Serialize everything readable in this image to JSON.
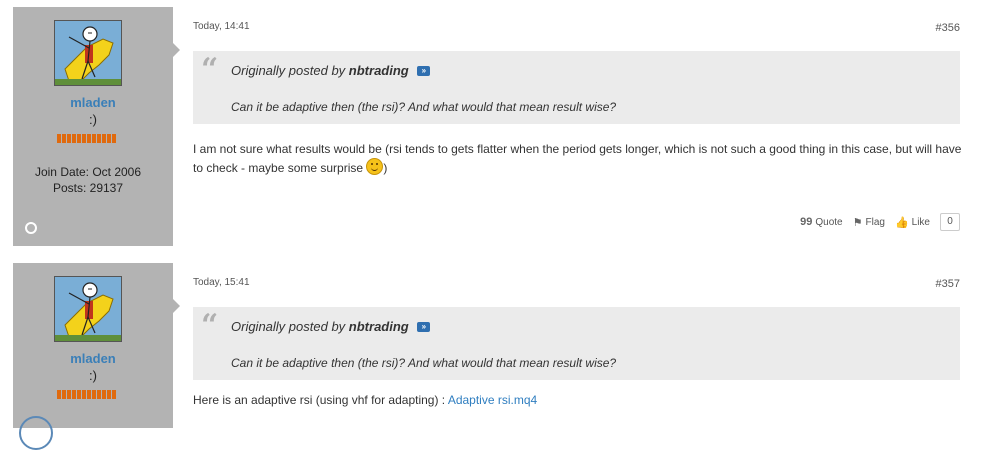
{
  "posts": [
    {
      "username": "mladen",
      "usertitle": ":)",
      "join_date": "Join Date: Oct 2006",
      "post_count": "Posts: 29137",
      "date": "Today, 14:41",
      "number": "#356",
      "quote": {
        "prefix": "Originally posted by",
        "author": "nbtrading",
        "text": "Can it be adaptive then (the rsi)? And what would that mean result wise?"
      },
      "message_text": "I am not sure what results would be (rsi tends to gets flatter when the period gets longer, which is not such a good thing in this case, but will have to check - maybe some surprise",
      "message_tail": ")",
      "actions": {
        "quote": "Quote",
        "flag": "Flag",
        "like": "Like",
        "like_count": "0"
      }
    },
    {
      "username": "mladen",
      "usertitle": ":)",
      "date": "Today, 15:41",
      "number": "#357",
      "quote": {
        "prefix": "Originally posted by",
        "author": "nbtrading",
        "text": "Can it be adaptive then (the rsi)? And what would that mean result wise?"
      },
      "message_text": "Here is an adaptive rsi (using vhf for adapting) :",
      "attachment": "Adaptive rsi.mq4"
    }
  ],
  "colors": {
    "userinfo_bg": "#b3b3b3",
    "username": "#3a7fb8",
    "reputation": "#e06a0e",
    "quote_bg": "#ebebeb",
    "link": "#2f7ec0"
  },
  "icons": {
    "quote": "quote-icon",
    "flag": "flag-icon",
    "like": "thumbs-up-icon",
    "status": "online-status-icon",
    "view_post": "view-post-icon"
  }
}
